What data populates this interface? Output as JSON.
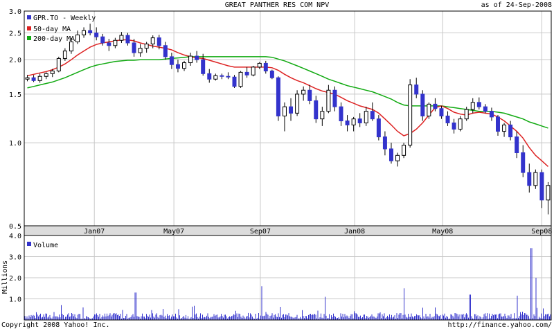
{
  "header": {
    "title": "GREAT PANTHER RES COM NPV",
    "asof": "as of 24-Sep-2008"
  },
  "footer": {
    "copyright": "Copyright 2008 Yahoo! Inc.",
    "url": "http://finance.yahoo.com/"
  },
  "colors": {
    "candle_down": "#3333cc",
    "ma50": "#dd2222",
    "ma200": "#11aa11",
    "volume": "#3333cc",
    "grid": "#c8c8c8",
    "xband": "#dcdcdc"
  },
  "chart_data": [
    {
      "type": "candlestick",
      "legend": [
        "GPR.TO - Weekly",
        "50-day MA",
        "200-day MA"
      ],
      "scale": "log",
      "ylim": [
        0.5,
        3.0
      ],
      "yticks": [
        {
          "v": 3.0,
          "label": "3.0"
        },
        {
          "v": 2.5,
          "label": "2.5"
        },
        {
          "v": 2.0,
          "label": "2.0"
        },
        {
          "v": 1.5,
          "label": "1.5"
        },
        {
          "v": 1.0,
          "label": "1.0"
        },
        {
          "v": 0.5,
          "label": "0.5"
        }
      ],
      "xticks": [
        "Jan07",
        "May07",
        "Sep07",
        "Jan08",
        "May08",
        "Sep08"
      ],
      "candles": [
        [
          1.7,
          1.76,
          1.67,
          1.72
        ],
        [
          1.72,
          1.76,
          1.66,
          1.68
        ],
        [
          1.68,
          1.78,
          1.65,
          1.74
        ],
        [
          1.74,
          1.8,
          1.7,
          1.78
        ],
        [
          1.78,
          1.85,
          1.73,
          1.82
        ],
        [
          1.82,
          2.05,
          1.8,
          2.02
        ],
        [
          2.02,
          2.2,
          1.98,
          2.15
        ],
        [
          2.15,
          2.4,
          2.1,
          2.32
        ],
        [
          2.32,
          2.55,
          2.28,
          2.46
        ],
        [
          2.46,
          2.62,
          2.4,
          2.55
        ],
        [
          2.55,
          2.7,
          2.45,
          2.5
        ],
        [
          2.5,
          2.62,
          2.35,
          2.42
        ],
        [
          2.42,
          2.48,
          2.25,
          2.3
        ],
        [
          2.3,
          2.38,
          2.15,
          2.25
        ],
        [
          2.25,
          2.4,
          2.2,
          2.35
        ],
        [
          2.35,
          2.52,
          2.3,
          2.45
        ],
        [
          2.45,
          2.5,
          2.25,
          2.3
        ],
        [
          2.3,
          2.38,
          2.05,
          2.12
        ],
        [
          2.12,
          2.28,
          2.05,
          2.2
        ],
        [
          2.2,
          2.32,
          2.12,
          2.28
        ],
        [
          2.28,
          2.45,
          2.2,
          2.4
        ],
        [
          2.4,
          2.46,
          2.18,
          2.25
        ],
        [
          2.25,
          2.32,
          2.0,
          2.05
        ],
        [
          2.05,
          2.12,
          1.85,
          1.92
        ],
        [
          1.92,
          2.0,
          1.8,
          1.86
        ],
        [
          1.86,
          1.98,
          1.82,
          1.95
        ],
        [
          1.95,
          2.12,
          1.9,
          2.06
        ],
        [
          2.06,
          2.15,
          1.95,
          2.0
        ],
        [
          2.0,
          2.1,
          1.75,
          1.78
        ],
        [
          1.78,
          1.85,
          1.65,
          1.7
        ],
        [
          1.7,
          1.78,
          1.68,
          1.75
        ],
        [
          1.75,
          1.78,
          1.7,
          1.74
        ],
        [
          1.74,
          1.8,
          1.7,
          1.73
        ],
        [
          1.73,
          1.76,
          1.58,
          1.6
        ],
        [
          1.6,
          1.82,
          1.58,
          1.8
        ],
        [
          1.8,
          1.88,
          1.72,
          1.76
        ],
        [
          1.76,
          1.9,
          1.74,
          1.88
        ],
        [
          1.88,
          1.96,
          1.85,
          1.94
        ],
        [
          1.94,
          1.98,
          1.78,
          1.82
        ],
        [
          1.82,
          1.84,
          1.7,
          1.72
        ],
        [
          1.72,
          1.74,
          1.2,
          1.25
        ],
        [
          1.25,
          1.4,
          1.1,
          1.35
        ],
        [
          1.35,
          1.45,
          1.2,
          1.28
        ],
        [
          1.28,
          1.55,
          1.25,
          1.5
        ],
        [
          1.5,
          1.6,
          1.42,
          1.55
        ],
        [
          1.55,
          1.62,
          1.38,
          1.42
        ],
        [
          1.42,
          1.48,
          1.18,
          1.22
        ],
        [
          1.22,
          1.35,
          1.15,
          1.3
        ],
        [
          1.3,
          1.62,
          1.28,
          1.55
        ],
        [
          1.55,
          1.6,
          1.3,
          1.35
        ],
        [
          1.35,
          1.4,
          1.15,
          1.2
        ],
        [
          1.2,
          1.26,
          1.1,
          1.16
        ],
        [
          1.16,
          1.24,
          1.1,
          1.22
        ],
        [
          1.22,
          1.28,
          1.14,
          1.18
        ],
        [
          1.18,
          1.35,
          1.15,
          1.3
        ],
        [
          1.3,
          1.4,
          1.2,
          1.22
        ],
        [
          1.22,
          1.26,
          1.02,
          1.05
        ],
        [
          1.05,
          1.1,
          0.9,
          0.95
        ],
        [
          0.95,
          1.0,
          0.84,
          0.86
        ],
        [
          0.86,
          0.92,
          0.82,
          0.9
        ],
        [
          0.9,
          1.0,
          0.88,
          0.98
        ],
        [
          0.98,
          1.7,
          0.96,
          1.62
        ],
        [
          1.62,
          1.72,
          1.45,
          1.5
        ],
        [
          1.5,
          1.55,
          1.2,
          1.25
        ],
        [
          1.25,
          1.4,
          1.22,
          1.38
        ],
        [
          1.38,
          1.45,
          1.3,
          1.33
        ],
        [
          1.33,
          1.36,
          1.22,
          1.25
        ],
        [
          1.25,
          1.3,
          1.15,
          1.18
        ],
        [
          1.18,
          1.22,
          1.08,
          1.12
        ],
        [
          1.12,
          1.25,
          1.1,
          1.22
        ],
        [
          1.22,
          1.35,
          1.2,
          1.32
        ],
        [
          1.32,
          1.45,
          1.28,
          1.4
        ],
        [
          1.4,
          1.46,
          1.32,
          1.35
        ],
        [
          1.35,
          1.38,
          1.28,
          1.3
        ],
        [
          1.3,
          1.34,
          1.2,
          1.24
        ],
        [
          1.24,
          1.26,
          1.06,
          1.1
        ],
        [
          1.1,
          1.18,
          1.05,
          1.16
        ],
        [
          1.16,
          1.2,
          1.02,
          1.05
        ],
        [
          1.05,
          1.1,
          0.88,
          0.92
        ],
        [
          0.92,
          0.98,
          0.75,
          0.78
        ],
        [
          0.78,
          0.84,
          0.66,
          0.7
        ],
        [
          0.7,
          0.8,
          0.68,
          0.78
        ],
        [
          0.78,
          0.8,
          0.58,
          0.62
        ],
        [
          0.62,
          0.72,
          0.55,
          0.7
        ]
      ],
      "ma50": [
        1.75,
        1.77,
        1.79,
        1.81,
        1.84,
        1.88,
        1.93,
        2.0,
        2.08,
        2.15,
        2.22,
        2.27,
        2.3,
        2.32,
        2.34,
        2.36,
        2.36,
        2.34,
        2.3,
        2.27,
        2.24,
        2.22,
        2.2,
        2.17,
        2.12,
        2.08,
        2.05,
        2.03,
        2.02,
        1.99,
        1.96,
        1.93,
        1.9,
        1.88,
        1.88,
        1.88,
        1.88,
        1.88,
        1.88,
        1.87,
        1.83,
        1.77,
        1.72,
        1.68,
        1.65,
        1.61,
        1.57,
        1.54,
        1.52,
        1.5,
        1.46,
        1.42,
        1.39,
        1.36,
        1.34,
        1.32,
        1.28,
        1.22,
        1.16,
        1.1,
        1.06,
        1.08,
        1.12,
        1.18,
        1.26,
        1.34,
        1.36,
        1.33,
        1.29,
        1.27,
        1.26,
        1.28,
        1.29,
        1.28,
        1.27,
        1.24,
        1.2,
        1.15,
        1.1,
        1.04,
        0.96,
        0.9,
        0.86,
        0.82
      ],
      "ma200": [
        1.58,
        1.6,
        1.62,
        1.64,
        1.66,
        1.69,
        1.72,
        1.76,
        1.8,
        1.84,
        1.88,
        1.91,
        1.93,
        1.95,
        1.97,
        1.98,
        1.99,
        1.99,
        2.0,
        2.0,
        2.0,
        2.0,
        2.01,
        2.02,
        2.03,
        2.04,
        2.05,
        2.05,
        2.05,
        2.05,
        2.05,
        2.05,
        2.05,
        2.05,
        2.05,
        2.05,
        2.05,
        2.05,
        2.05,
        2.04,
        2.01,
        1.98,
        1.94,
        1.9,
        1.86,
        1.82,
        1.78,
        1.74,
        1.7,
        1.67,
        1.64,
        1.61,
        1.59,
        1.57,
        1.55,
        1.53,
        1.5,
        1.47,
        1.44,
        1.4,
        1.37,
        1.36,
        1.36,
        1.36,
        1.36,
        1.36,
        1.36,
        1.35,
        1.34,
        1.33,
        1.32,
        1.31,
        1.3,
        1.3,
        1.3,
        1.29,
        1.28,
        1.26,
        1.24,
        1.22,
        1.19,
        1.17,
        1.15,
        1.13
      ]
    },
    {
      "type": "bar",
      "legend": [
        "Volume"
      ],
      "ylabel": "Millions",
      "ylim": [
        0,
        4.0
      ],
      "yticks": [
        {
          "v": 4.0,
          "label": "4.0"
        },
        {
          "v": 3.0,
          "label": "3.0"
        },
        {
          "v": 2.0,
          "label": "2.0"
        },
        {
          "v": 1.0,
          "label": "1.0"
        }
      ],
      "spikes": [
        [
          0.11,
          0.6
        ],
        [
          0.21,
          1.3
        ],
        [
          0.45,
          1.6
        ],
        [
          0.57,
          1.1
        ],
        [
          0.72,
          1.5
        ],
        [
          0.845,
          1.2
        ],
        [
          0.935,
          1.15
        ],
        [
          0.962,
          3.4
        ],
        [
          0.97,
          2.0
        ]
      ]
    }
  ]
}
